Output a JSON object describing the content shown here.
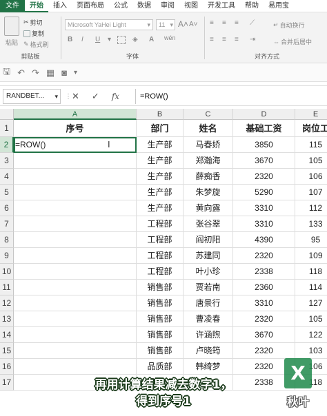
{
  "menu": {
    "items": [
      "文件",
      "开始",
      "插入",
      "页面布局",
      "公式",
      "数据",
      "审阅",
      "视图",
      "开发工具",
      "帮助",
      "易用宝"
    ],
    "active_index": 1
  },
  "ribbon": {
    "clipboard": {
      "paste": "粘贴",
      "cut": "剪切",
      "copy": "复制",
      "format_painter": "格式刷",
      "label": "剪贴板"
    },
    "font": {
      "font_name": "Microsoft YaHei Light",
      "font_size": "11",
      "bold": "B",
      "italic": "I",
      "underline": "U",
      "grow": "A",
      "shrink": "A",
      "label": "字体",
      "wen": "wén"
    },
    "alignment": {
      "wrap": "自动换行",
      "merge": "合并后居中",
      "label": "对齐方式"
    }
  },
  "formula_bar": {
    "name_box": "RANDBET...",
    "cancel": "✕",
    "enter": "✓",
    "fx": "fx",
    "formula": "=ROW()"
  },
  "grid": {
    "columns": [
      "A",
      "B",
      "C",
      "D",
      "E"
    ],
    "selected_column": "A",
    "rows": [
      "1",
      "2",
      "3",
      "4",
      "5",
      "6",
      "7",
      "8",
      "9",
      "10",
      "11",
      "12",
      "13",
      "14",
      "15",
      "16",
      "17"
    ],
    "selected_row": "2",
    "header": [
      "序号",
      "部门",
      "姓名",
      "基础工资",
      "岗位工"
    ],
    "data": [
      [
        "=ROW()",
        "生产部",
        "马春娇",
        "3850",
        "115"
      ],
      [
        "",
        "生产部",
        "郑瀚海",
        "3670",
        "105"
      ],
      [
        "",
        "生产部",
        "薛痴香",
        "2320",
        "106"
      ],
      [
        "",
        "生产部",
        "朱梦旋",
        "5290",
        "107"
      ],
      [
        "",
        "生产部",
        "黄向露",
        "3310",
        "112"
      ],
      [
        "",
        "工程部",
        "张谷翠",
        "3310",
        "133"
      ],
      [
        "",
        "工程部",
        "阎初阳",
        "4390",
        "95"
      ],
      [
        "",
        "工程部",
        "苏建同",
        "2320",
        "109"
      ],
      [
        "",
        "工程部",
        "叶小珍",
        "2338",
        "118"
      ],
      [
        "",
        "销售部",
        "贾若南",
        "2360",
        "114"
      ],
      [
        "",
        "销售部",
        "唐景行",
        "3310",
        "127"
      ],
      [
        "",
        "销售部",
        "曹凌春",
        "2320",
        "105"
      ],
      [
        "",
        "销售部",
        "许涵煦",
        "3670",
        "122"
      ],
      [
        "",
        "销售部",
        "卢晓筠",
        "2320",
        "103"
      ],
      [
        "",
        "品质部",
        "韩绮梦",
        "2320",
        "106"
      ],
      [
        "",
        "品质部",
        "",
        "2338",
        "118"
      ]
    ]
  },
  "caption": {
    "line1": "再用计算结果减去数字1，",
    "line2": "得到序号1"
  },
  "watermark": {
    "icon": "excel-logo-icon",
    "text": "秋叶"
  },
  "colors": {
    "accent": "#217346",
    "caption_stroke": "#1a3a1a"
  }
}
